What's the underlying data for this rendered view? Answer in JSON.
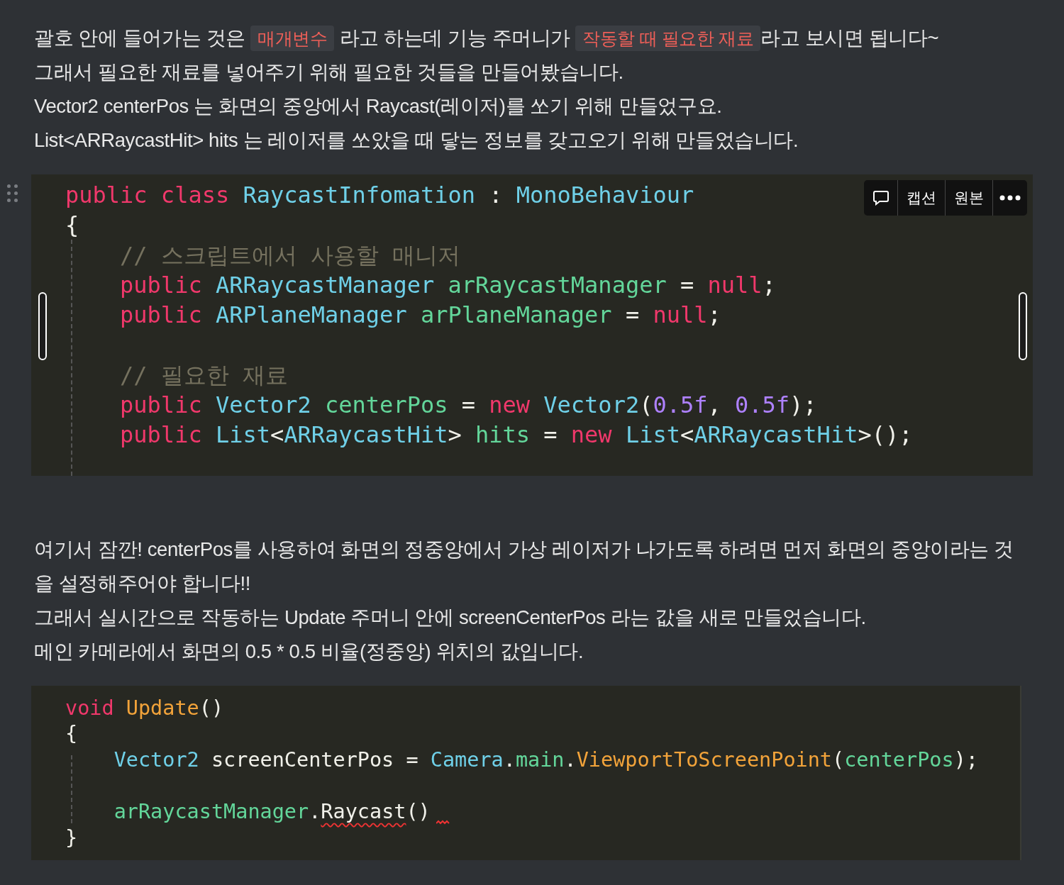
{
  "blocks": [
    {
      "kind": "text",
      "lines": [
        [
          {
            "text": "괄호 안에 들어가는 것은 ",
            "kind": "text"
          },
          {
            "text": "매개변수",
            "kind": "code"
          },
          {
            "text": " 라고 하는데 기능 주머니가 ",
            "kind": "text"
          },
          {
            "text": "작동할 때 필요한 재료",
            "kind": "code"
          },
          {
            "text": "라고 보시면 됩니다~",
            "kind": "text"
          }
        ],
        [
          {
            "text": "그래서 필요한 재료를 넣어주기 위해 필요한 것들을 만들어봤습니다.",
            "kind": "text"
          }
        ],
        [
          {
            "text": "Vector2 centerPos 는 화면의 중앙에서 Raycast(레이저)를 쏘기 위해 만들었구요.",
            "kind": "text"
          }
        ],
        [
          {
            "text": "List<ARRaycastHit> hits 는 레이저를 쏘았을 때 닿는 정보를 갖고오기 위해 만들었습니다.",
            "kind": "text"
          }
        ]
      ]
    },
    {
      "kind": "code",
      "selected": true,
      "toolbar": {
        "caption": "캡션",
        "original": "원본"
      },
      "groups": [
        [
          {
            "tokens": [
              {
                "t": "public class ",
                "kind": "keyword"
              },
              {
                "t": "RaycastInfomation",
                "kind": "type"
              },
              {
                "t": " : ",
                "kind": "plain"
              },
              {
                "t": "MonoBehaviour",
                "kind": "type"
              }
            ]
          },
          {
            "tokens": [
              {
                "t": "{",
                "kind": "plain"
              }
            ]
          },
          {
            "tokens": [
              {
                "t": "    // 스크립트에서 사용할 매니저",
                "kind": "comment"
              }
            ]
          },
          {
            "tokens": [
              {
                "t": "    public ",
                "kind": "keyword"
              },
              {
                "t": "ARRaycastManager ",
                "kind": "type"
              },
              {
                "t": "arRaycastManager",
                "kind": "ident"
              },
              {
                "t": " = ",
                "kind": "plain"
              },
              {
                "t": "null",
                "kind": "keyword"
              },
              {
                "t": ";",
                "kind": "plain"
              }
            ]
          },
          {
            "tokens": [
              {
                "t": "    public ",
                "kind": "keyword"
              },
              {
                "t": "ARPlaneManager ",
                "kind": "type"
              },
              {
                "t": "arPlaneManager",
                "kind": "ident"
              },
              {
                "t": " = ",
                "kind": "plain"
              },
              {
                "t": "null",
                "kind": "keyword"
              },
              {
                "t": ";",
                "kind": "plain"
              }
            ]
          }
        ],
        [
          {
            "tokens": [
              {
                "t": "    // 필요한 재료",
                "kind": "comment"
              }
            ]
          },
          {
            "tokens": [
              {
                "t": "    public ",
                "kind": "keyword"
              },
              {
                "t": "Vector2 ",
                "kind": "type"
              },
              {
                "t": "centerPos",
                "kind": "ident"
              },
              {
                "t": " = ",
                "kind": "plain"
              },
              {
                "t": "new ",
                "kind": "keyword"
              },
              {
                "t": "Vector2",
                "kind": "type"
              },
              {
                "t": "(",
                "kind": "plain"
              },
              {
                "t": "0.5f",
                "kind": "number"
              },
              {
                "t": ", ",
                "kind": "plain"
              },
              {
                "t": "0.5f",
                "kind": "number"
              },
              {
                "t": ");",
                "kind": "plain"
              }
            ]
          },
          {
            "tokens": [
              {
                "t": "    public ",
                "kind": "keyword"
              },
              {
                "t": "List",
                "kind": "type"
              },
              {
                "t": "<",
                "kind": "plain"
              },
              {
                "t": "ARRaycastHit",
                "kind": "type"
              },
              {
                "t": "> ",
                "kind": "plain"
              },
              {
                "t": "hits",
                "kind": "ident"
              },
              {
                "t": " = ",
                "kind": "plain"
              },
              {
                "t": "new ",
                "kind": "keyword"
              },
              {
                "t": "List",
                "kind": "type"
              },
              {
                "t": "<",
                "kind": "plain"
              },
              {
                "t": "ARRaycastHit",
                "kind": "type"
              },
              {
                "t": ">();",
                "kind": "plain"
              }
            ]
          }
        ]
      ]
    },
    {
      "kind": "text",
      "lines": [
        [
          {
            "text": "여기서 잠깐! centerPos를 사용하여 화면의 정중앙에서 가상 레이저가 나가도록 하려면 먼저 화면의 중앙이라는 것을 설정해주어야 합니다!!",
            "kind": "text"
          }
        ],
        [
          {
            "text": "그래서 실시간으로 작동하는 Update 주머니 안에 screenCenterPos 라는 값을 새로 만들었습니다.",
            "kind": "text"
          }
        ],
        [
          {
            "text": "메인 카메라에서 화면의 0.5 * 0.5 비율(정중앙) 위치의 값입니다.",
            "kind": "text"
          }
        ]
      ]
    },
    {
      "kind": "code",
      "selected": false,
      "groups": [
        [
          {
            "tokens": [
              {
                "t": "void ",
                "kind": "keyword"
              },
              {
                "t": "Update",
                "kind": "method"
              },
              {
                "t": "()",
                "kind": "plain"
              }
            ]
          },
          {
            "tokens": [
              {
                "t": "{",
                "kind": "plain"
              }
            ]
          },
          {
            "tokens": [
              {
                "t": "    Vector2 ",
                "kind": "type"
              },
              {
                "t": "screenCenterPos = ",
                "kind": "plain"
              },
              {
                "t": "Camera",
                "kind": "type"
              },
              {
                "t": ".",
                "kind": "plain"
              },
              {
                "t": "main",
                "kind": "ident"
              },
              {
                "t": ".",
                "kind": "plain"
              },
              {
                "t": "ViewportToScreenPoint",
                "kind": "method"
              },
              {
                "t": "(",
                "kind": "plain"
              },
              {
                "t": "centerPos",
                "kind": "ident"
              },
              {
                "t": ");",
                "kind": "plain"
              }
            ]
          }
        ],
        [
          {
            "tokens": [
              {
                "t": "    arRaycastManager",
                "kind": "ident",
                "error": false
              },
              {
                "t": ".",
                "kind": "plain",
                "error": false
              },
              {
                "t": "Raycast",
                "kind": "plain",
                "error": true
              },
              {
                "t": "()",
                "kind": "plain",
                "error": false
              }
            ],
            "trailing_error": true
          },
          {
            "tokens": [
              {
                "t": "}",
                "kind": "plain"
              }
            ]
          }
        ]
      ]
    }
  ]
}
